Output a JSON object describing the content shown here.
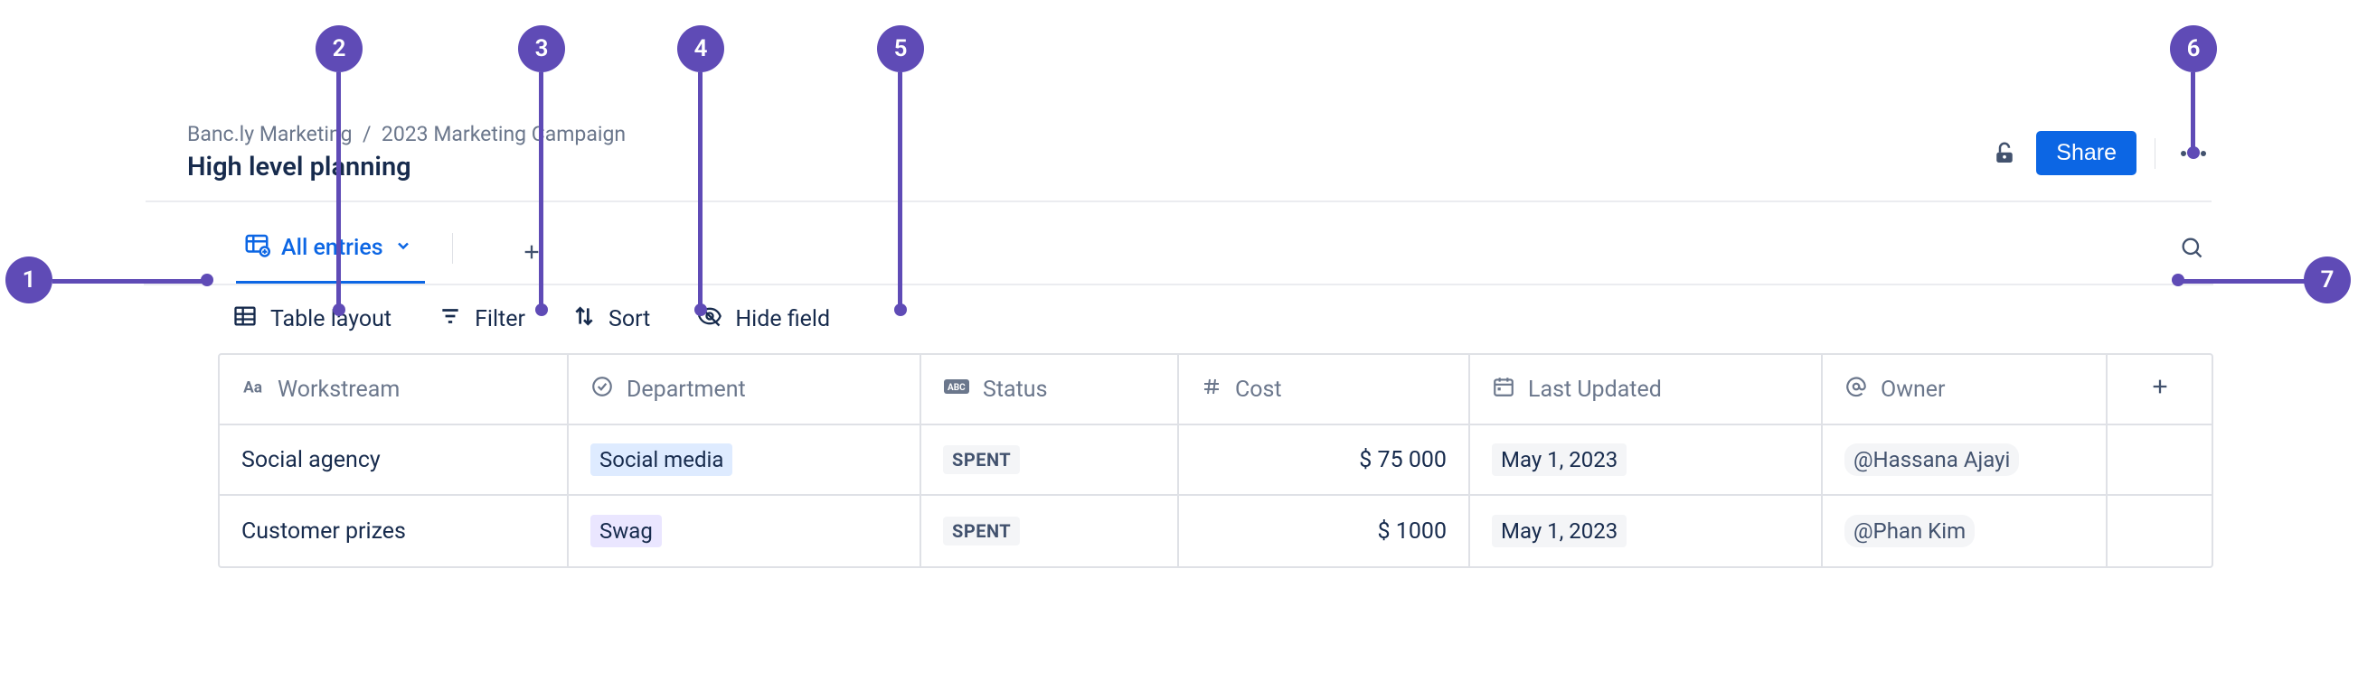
{
  "callouts": [
    "1",
    "2",
    "3",
    "4",
    "5",
    "6",
    "7"
  ],
  "breadcrumb": {
    "space": "Banc.ly Marketing",
    "parent": "2023 Marketing Campaign"
  },
  "title": "High level planning",
  "share_label": "Share",
  "view": {
    "name": "All entries"
  },
  "toolbar": {
    "layout": "Table layout",
    "filter": "Filter",
    "sort": "Sort",
    "hide": "Hide field"
  },
  "columns": {
    "workstream": "Workstream",
    "department": "Department",
    "status": "Status",
    "cost": "Cost",
    "last_updated": "Last Updated",
    "owner": "Owner"
  },
  "rows": [
    {
      "workstream": "Social agency",
      "department": "Social media",
      "dept_color": "blue",
      "status": "SPENT",
      "cost": "$ 75 000",
      "last_updated": "May 1, 2023",
      "owner": "@Hassana Ajayi"
    },
    {
      "workstream": "Customer prizes",
      "department": "Swag",
      "dept_color": "purple",
      "status": "SPENT",
      "cost": "$ 1000",
      "last_updated": "May 1, 2023",
      "owner": "@Phan Kim"
    }
  ]
}
